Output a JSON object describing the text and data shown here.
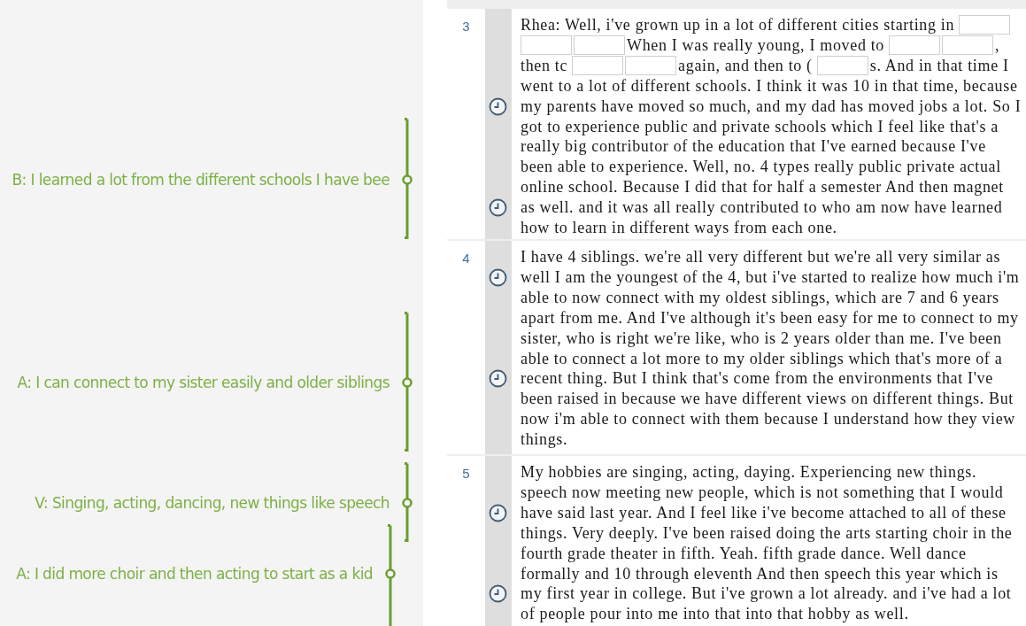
{
  "codes": [
    {
      "label": "B: I learned a lot from the different schools I have bee"
    },
    {
      "label": "A: I can connect to my sister easily and older siblings"
    },
    {
      "label": "V: Singing, acting, dancing, new things like speech"
    },
    {
      "label": "A: I did more choir and then acting to start as a kid"
    }
  ],
  "paragraphs": [
    {
      "number": "3",
      "segments": [
        {
          "kind": "text",
          "text": "Rhea: Well, i've grown up in a lot of different cities starting in"
        },
        {
          "kind": "redaction"
        },
        {
          "kind": "break"
        },
        {
          "kind": "redaction"
        },
        {
          "kind": "redaction"
        },
        {
          "kind": "text",
          "text": "When I was really young, I moved to"
        },
        {
          "kind": "redaction"
        },
        {
          "kind": "redaction"
        },
        {
          "kind": "text",
          "text": ","
        },
        {
          "kind": "break"
        },
        {
          "kind": "text",
          "text": "then tc"
        },
        {
          "kind": "redaction"
        },
        {
          "kind": "redaction"
        },
        {
          "kind": "text",
          "text": "again, and then to ("
        },
        {
          "kind": "redaction"
        },
        {
          "kind": "text",
          "text": "s. And in that time I"
        },
        {
          "kind": "passage",
          "text": "went to a lot of different schools. I think it was 10 in that time, because my parents have moved so much, and my dad has moved jobs a lot. So I got to experience public and private schools which I feel like that's a really big contributor of the education that I've earned because I've been able to experience. Well, no. 4 types really public private actual online school. Because I did that for half a semester And then magnet as well. and it was all really contributed to who am now have learned how to learn in different ways from each one."
        }
      ]
    },
    {
      "number": "4",
      "segments": [
        {
          "kind": "passage",
          "text": "I have 4 siblings. we're all very different but we're all very similar as well I am the youngest of the 4, but i've started to realize how much i'm able to now connect with my oldest siblings, which are 7 and 6 years apart from me. And I've although it's been easy for me to connect to my sister, who is right we're like, who is 2 years older than me. I've been able to connect a lot more to my older siblings which that's more of a recent thing. But I think that's come from the environments that I've been raised in because we have different views on different things. But now i'm able to connect with them because I understand how they view things."
        }
      ]
    },
    {
      "number": "5",
      "segments": [
        {
          "kind": "passage",
          "text": "My hobbies are singing, acting, daying. Experiencing new things. speech now meeting new people, which is not something that I would have said last year. And I feel like i've become attached to all of these things. Very deeply. I've been raised doing the arts starting choir in the fourth grade theater in fifth. Yeah. fifth grade dance. Well dance formally and 10 through eleventh And then speech this year which is my first year in college. But i've grown a lot already. and i've had a lot of people pour into me into that into that hobby as well."
        }
      ]
    }
  ]
}
